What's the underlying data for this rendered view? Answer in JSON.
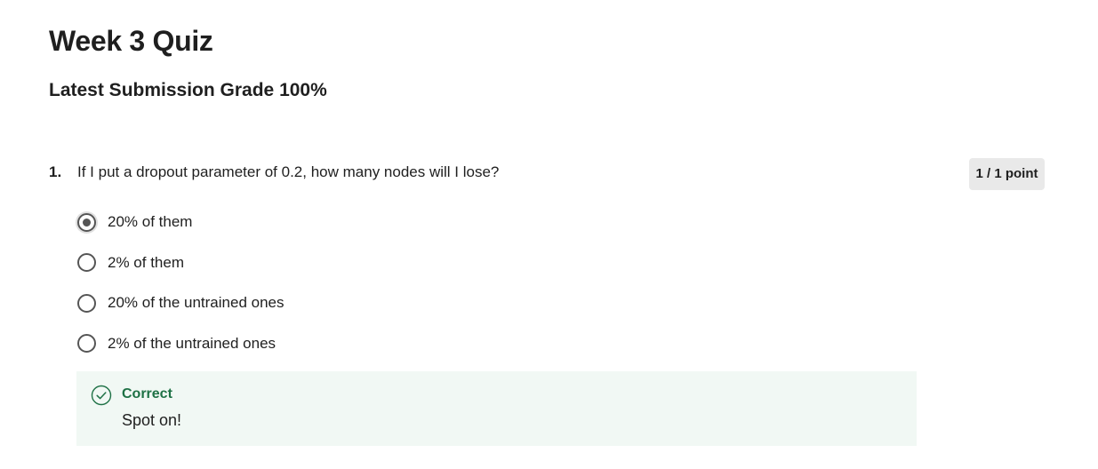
{
  "quiz": {
    "title": "Week 3 Quiz",
    "grade_line": "Latest Submission Grade 100%"
  },
  "question": {
    "number": "1.",
    "text": "If I put a dropout parameter of 0.2, how many nodes will I lose?",
    "points": "1 / 1 point",
    "options": [
      {
        "label": "20% of them",
        "selected": true
      },
      {
        "label": "2% of them",
        "selected": false
      },
      {
        "label": "20% of the untrained ones",
        "selected": false
      },
      {
        "label": "2% of the untrained ones",
        "selected": false
      }
    ]
  },
  "feedback": {
    "status": "Correct",
    "message": "Spot on!",
    "icon": "check-circle-icon"
  },
  "colors": {
    "correct_green": "#1e7145",
    "feedback_bg": "#f1f8f4",
    "badge_bg": "#e9e9e9"
  }
}
